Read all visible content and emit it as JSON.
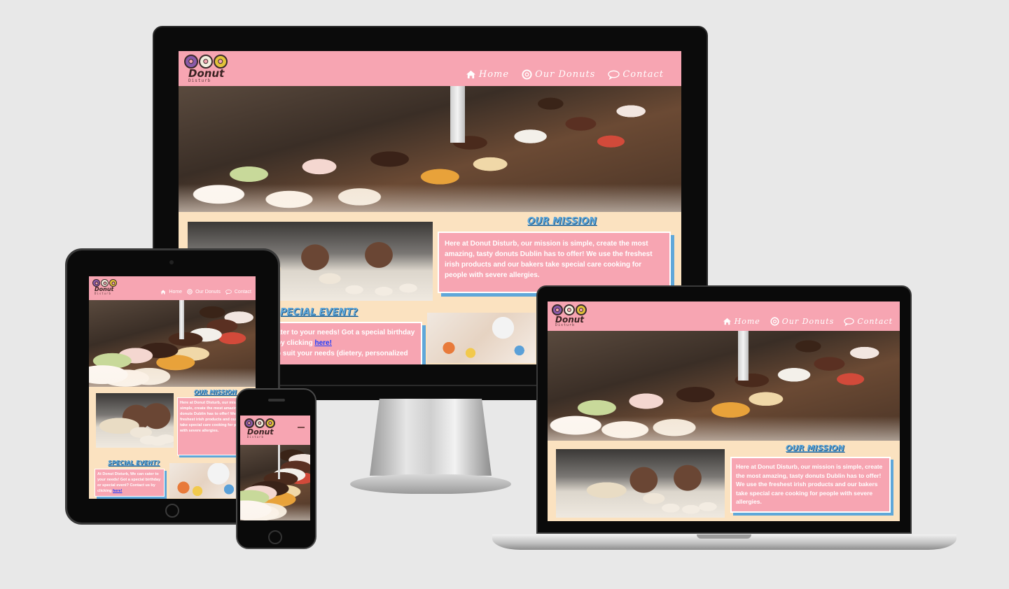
{
  "site": {
    "logo_word": "Donut",
    "logo_sub": "Disturb",
    "nav": [
      {
        "icon": "home-icon",
        "label": "Home"
      },
      {
        "icon": "life-ring-icon",
        "label": "Our Donuts"
      },
      {
        "icon": "speech-bubble-icon",
        "label": "Contact"
      }
    ],
    "mission_heading": "OUR MISSION",
    "mission_text": "Here at Donut Disturb, our mission is simple, create the most amazing, tasty donuts Dublin has to offer! We use the freshest irish products and our bakers take special care cooking for people with severe allergies.",
    "event_heading": "SPECIAL EVENT?",
    "event_text_prefix": "At Donut Disturb, We can cater to your needs! Got a special birthday or special event? Contact us by clicking",
    "event_link": "here!",
    "event_text_suffix": "to suit your needs (dietery, personalized",
    "monitor_event_line1": "ater to your needs! Got a special birthday",
    "monitor_event_line2_prefix": "by clicking",
    "monitor_event_line3": "o suit your needs (dietery, personalized",
    "monitor_event_heading": "PECIAL EVENT?"
  },
  "colors": {
    "nav_pink": "#f7a5b2",
    "cream": "#fbe2c0",
    "accent_blue": "#5fa7d9",
    "page_bg": "#e8e8e8"
  }
}
